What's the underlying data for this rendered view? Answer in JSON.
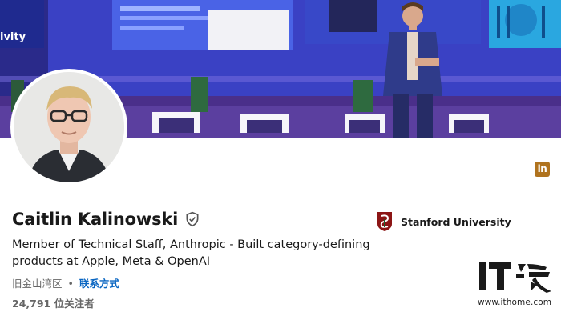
{
  "profile": {
    "name": "Caitlin Kalinowski",
    "headline": "Member of Technical Staff, Anthropic - Built category-defining products at Apple, Meta & OpenAI",
    "location": "旧金山湾区",
    "separator": "•",
    "contact_label": "联系方式",
    "followers": "24,791 位关注者"
  },
  "education": {
    "school": "Stanford University"
  },
  "badge": {
    "label": "in",
    "icon": "linkedin-icon"
  },
  "banner": {
    "screen_text": "ivity"
  },
  "watermark": {
    "url": "www.ithome.com"
  },
  "colors": {
    "accent": "#0a66c2",
    "badge": "#b0731e",
    "stanford": "#8c1515",
    "banner": "#3a3fb8"
  }
}
